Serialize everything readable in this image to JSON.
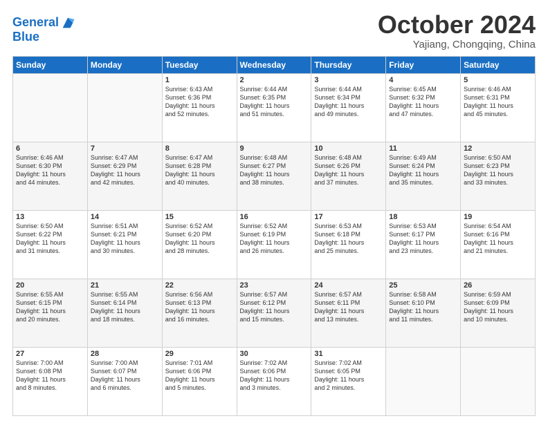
{
  "logo": {
    "line1": "General",
    "line2": "Blue"
  },
  "title": "October 2024",
  "location": "Yajiang, Chongqing, China",
  "days_of_week": [
    "Sunday",
    "Monday",
    "Tuesday",
    "Wednesday",
    "Thursday",
    "Friday",
    "Saturday"
  ],
  "weeks": [
    [
      {
        "day": "",
        "text": ""
      },
      {
        "day": "",
        "text": ""
      },
      {
        "day": "1",
        "text": "Sunrise: 6:43 AM\nSunset: 6:36 PM\nDaylight: 11 hours\nand 52 minutes."
      },
      {
        "day": "2",
        "text": "Sunrise: 6:44 AM\nSunset: 6:35 PM\nDaylight: 11 hours\nand 51 minutes."
      },
      {
        "day": "3",
        "text": "Sunrise: 6:44 AM\nSunset: 6:34 PM\nDaylight: 11 hours\nand 49 minutes."
      },
      {
        "day": "4",
        "text": "Sunrise: 6:45 AM\nSunset: 6:32 PM\nDaylight: 11 hours\nand 47 minutes."
      },
      {
        "day": "5",
        "text": "Sunrise: 6:46 AM\nSunset: 6:31 PM\nDaylight: 11 hours\nand 45 minutes."
      }
    ],
    [
      {
        "day": "6",
        "text": "Sunrise: 6:46 AM\nSunset: 6:30 PM\nDaylight: 11 hours\nand 44 minutes."
      },
      {
        "day": "7",
        "text": "Sunrise: 6:47 AM\nSunset: 6:29 PM\nDaylight: 11 hours\nand 42 minutes."
      },
      {
        "day": "8",
        "text": "Sunrise: 6:47 AM\nSunset: 6:28 PM\nDaylight: 11 hours\nand 40 minutes."
      },
      {
        "day": "9",
        "text": "Sunrise: 6:48 AM\nSunset: 6:27 PM\nDaylight: 11 hours\nand 38 minutes."
      },
      {
        "day": "10",
        "text": "Sunrise: 6:48 AM\nSunset: 6:26 PM\nDaylight: 11 hours\nand 37 minutes."
      },
      {
        "day": "11",
        "text": "Sunrise: 6:49 AM\nSunset: 6:24 PM\nDaylight: 11 hours\nand 35 minutes."
      },
      {
        "day": "12",
        "text": "Sunrise: 6:50 AM\nSunset: 6:23 PM\nDaylight: 11 hours\nand 33 minutes."
      }
    ],
    [
      {
        "day": "13",
        "text": "Sunrise: 6:50 AM\nSunset: 6:22 PM\nDaylight: 11 hours\nand 31 minutes."
      },
      {
        "day": "14",
        "text": "Sunrise: 6:51 AM\nSunset: 6:21 PM\nDaylight: 11 hours\nand 30 minutes."
      },
      {
        "day": "15",
        "text": "Sunrise: 6:52 AM\nSunset: 6:20 PM\nDaylight: 11 hours\nand 28 minutes."
      },
      {
        "day": "16",
        "text": "Sunrise: 6:52 AM\nSunset: 6:19 PM\nDaylight: 11 hours\nand 26 minutes."
      },
      {
        "day": "17",
        "text": "Sunrise: 6:53 AM\nSunset: 6:18 PM\nDaylight: 11 hours\nand 25 minutes."
      },
      {
        "day": "18",
        "text": "Sunrise: 6:53 AM\nSunset: 6:17 PM\nDaylight: 11 hours\nand 23 minutes."
      },
      {
        "day": "19",
        "text": "Sunrise: 6:54 AM\nSunset: 6:16 PM\nDaylight: 11 hours\nand 21 minutes."
      }
    ],
    [
      {
        "day": "20",
        "text": "Sunrise: 6:55 AM\nSunset: 6:15 PM\nDaylight: 11 hours\nand 20 minutes."
      },
      {
        "day": "21",
        "text": "Sunrise: 6:55 AM\nSunset: 6:14 PM\nDaylight: 11 hours\nand 18 minutes."
      },
      {
        "day": "22",
        "text": "Sunrise: 6:56 AM\nSunset: 6:13 PM\nDaylight: 11 hours\nand 16 minutes."
      },
      {
        "day": "23",
        "text": "Sunrise: 6:57 AM\nSunset: 6:12 PM\nDaylight: 11 hours\nand 15 minutes."
      },
      {
        "day": "24",
        "text": "Sunrise: 6:57 AM\nSunset: 6:11 PM\nDaylight: 11 hours\nand 13 minutes."
      },
      {
        "day": "25",
        "text": "Sunrise: 6:58 AM\nSunset: 6:10 PM\nDaylight: 11 hours\nand 11 minutes."
      },
      {
        "day": "26",
        "text": "Sunrise: 6:59 AM\nSunset: 6:09 PM\nDaylight: 11 hours\nand 10 minutes."
      }
    ],
    [
      {
        "day": "27",
        "text": "Sunrise: 7:00 AM\nSunset: 6:08 PM\nDaylight: 11 hours\nand 8 minutes."
      },
      {
        "day": "28",
        "text": "Sunrise: 7:00 AM\nSunset: 6:07 PM\nDaylight: 11 hours\nand 6 minutes."
      },
      {
        "day": "29",
        "text": "Sunrise: 7:01 AM\nSunset: 6:06 PM\nDaylight: 11 hours\nand 5 minutes."
      },
      {
        "day": "30",
        "text": "Sunrise: 7:02 AM\nSunset: 6:06 PM\nDaylight: 11 hours\nand 3 minutes."
      },
      {
        "day": "31",
        "text": "Sunrise: 7:02 AM\nSunset: 6:05 PM\nDaylight: 11 hours\nand 2 minutes."
      },
      {
        "day": "",
        "text": ""
      },
      {
        "day": "",
        "text": ""
      }
    ]
  ]
}
